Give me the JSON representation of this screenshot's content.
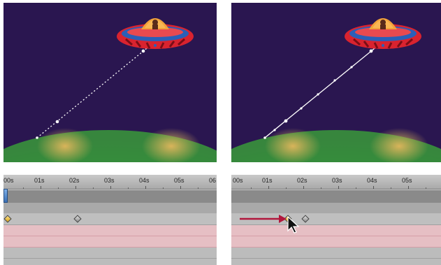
{
  "timeline": {
    "ticks": [
      "00s",
      "01s",
      "02s",
      "03s",
      "04s",
      "05s",
      "06"
    ]
  },
  "right_timeline": {
    "ticks": [
      "00s",
      "01s",
      "02s",
      "03s",
      "04s",
      "05s"
    ]
  },
  "colors": {
    "sky": "#2a1650",
    "planet": "#2f9a3b",
    "ufo_body": "#d9232f",
    "ufo_dome": "#f3a23a",
    "motion_path": "#ffffff",
    "arrow": "#b1173c",
    "keyframe_selected": "#e7b53a",
    "keyframe": "#9a9a9a"
  },
  "icons": {
    "ufo": "ufo-icon",
    "cursor": "mouse-pointer-icon",
    "arrow": "arrow-right-icon"
  }
}
